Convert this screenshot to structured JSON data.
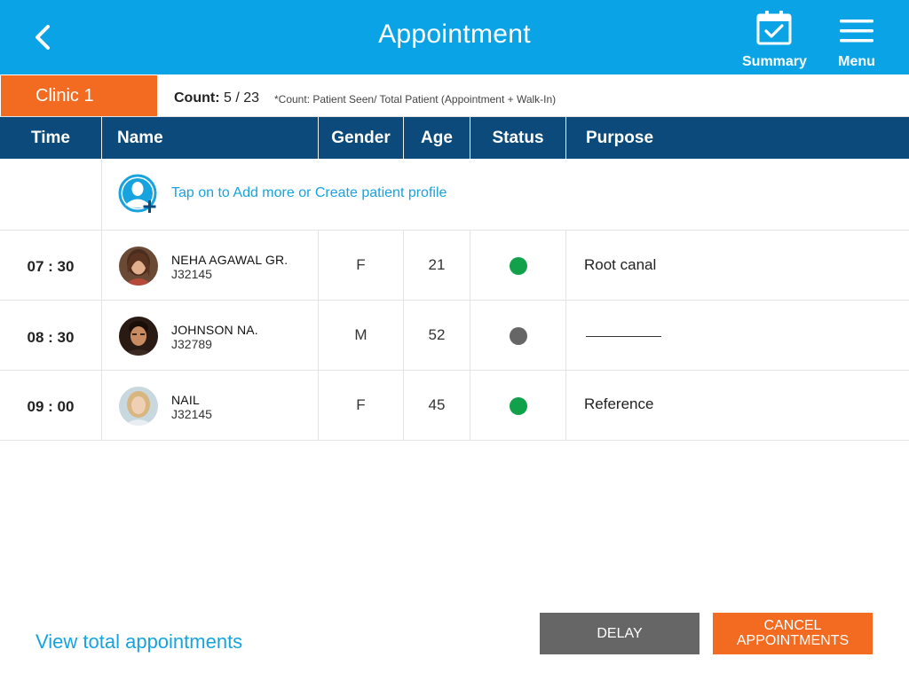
{
  "header": {
    "title": "Appointment",
    "summary_label": "Summary",
    "menu_label": "Menu",
    "bg_color": "#0aa4e6"
  },
  "clinic": {
    "tab_label": "Clinic 1",
    "count_label": "Count:",
    "count_value": "5 / 23",
    "count_note": "*Count: Patient Seen/ Total Patient (Appointment + Walk-In)"
  },
  "table": {
    "headers": [
      "Time",
      "Name",
      "Gender",
      "Age",
      "Status",
      "Purpose"
    ],
    "add_prompt": "Tap on to Add more or Create patient profile",
    "rows": [
      {
        "time": "07 : 30",
        "name": "NEHA AGAWAL GR.",
        "id": "J32145",
        "gender": "F",
        "age": "21",
        "status": "seen",
        "status_color": "#12a14b",
        "purpose": "Root canal"
      },
      {
        "time": "08 : 30",
        "name": "JOHNSON NA.",
        "id": "J32789",
        "gender": "M",
        "age": "52",
        "status": "pending",
        "status_color": "#666666",
        "purpose": ""
      },
      {
        "time": "09 : 00",
        "name": "NAIL",
        "id": "J32145",
        "gender": "F",
        "age": "45",
        "status": "seen",
        "status_color": "#12a14b",
        "purpose": "Reference"
      }
    ]
  },
  "footer": {
    "view_total": "View total appointments",
    "delay_label": "DELAY",
    "cancel_line1": "CANCEL",
    "cancel_line2": "APPOINTMENTS"
  },
  "colors": {
    "accent_blue": "#0aa4e6",
    "table_header": "#0b4a7a",
    "orange": "#f26b21",
    "gray_button": "#666666"
  }
}
